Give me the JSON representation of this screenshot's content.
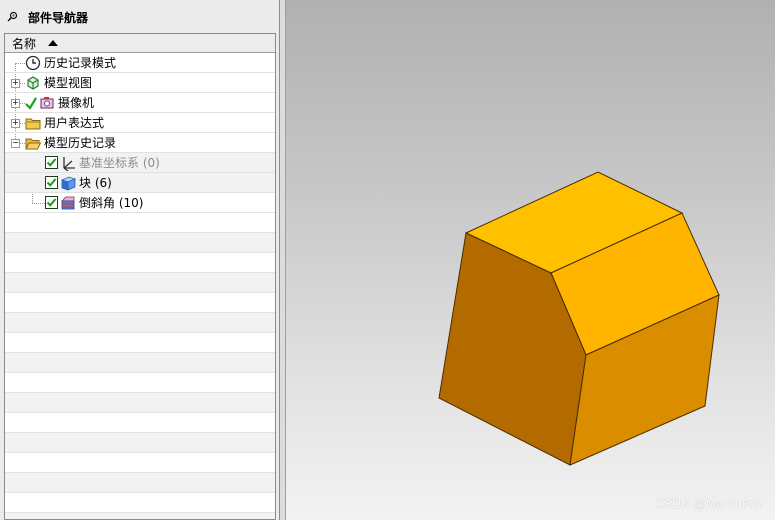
{
  "navigator": {
    "title": "部件导航器",
    "column_name": "名称",
    "items": [
      {
        "label": "历史记录模式",
        "icon": "clock-icon"
      },
      {
        "label": "模型视图",
        "icon": "model-views-icon"
      },
      {
        "label": "摄像机",
        "icon": "camera-icon"
      },
      {
        "label": "用户表达式",
        "icon": "folder-icon"
      },
      {
        "label": "模型历史记录",
        "icon": "open-folder-icon"
      },
      {
        "label": "基准坐标系 (0)",
        "icon": "datum-csys-icon",
        "checked": true,
        "dimmed": true
      },
      {
        "label": "块 (6)",
        "icon": "block-icon",
        "checked": true
      },
      {
        "label": "倒斜角 (10)",
        "icon": "chamfer-icon",
        "checked": true
      }
    ]
  },
  "viewport": {
    "watermark": "CSDN @MarcoPro",
    "model_colors": {
      "top": "#ffc000",
      "front_left": "#b36b00",
      "front_right": "#d98a00",
      "chamfer": "#ffb000",
      "edge": "#4a2c00"
    }
  }
}
